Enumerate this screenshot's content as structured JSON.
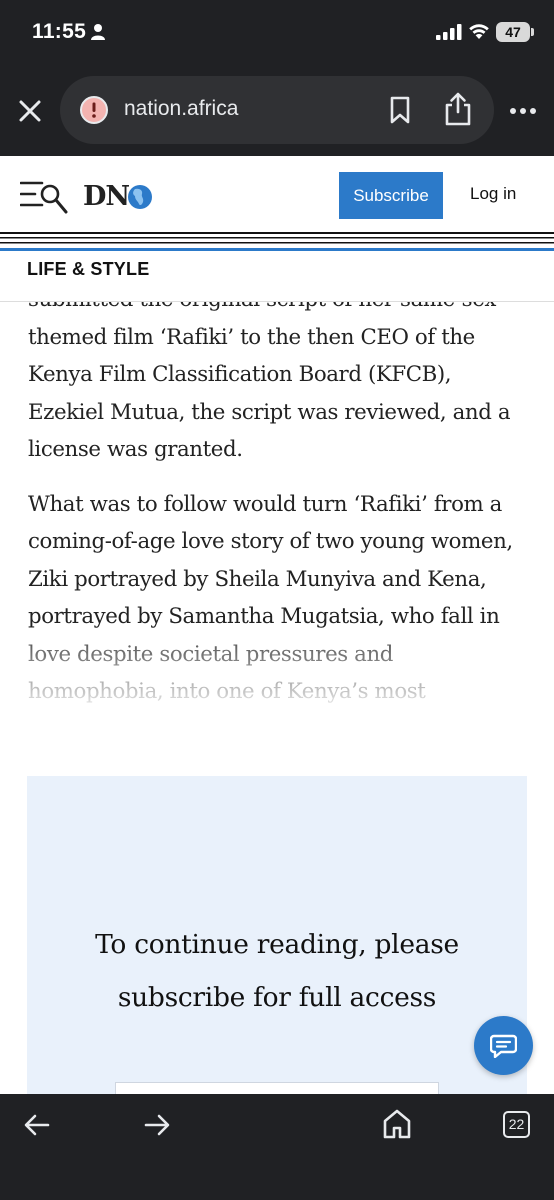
{
  "status_bar": {
    "time": "11:55",
    "battery": "47"
  },
  "browser": {
    "url": "nation.africa",
    "tab_count": "22"
  },
  "site": {
    "logo_text": "DN",
    "subscribe_label": "Subscribe",
    "login_label": "Log in",
    "section": "LIFE & STYLE",
    "brand_color": "#2c7ac9"
  },
  "article": {
    "paragraphs": [
      "submitted the original script of her same-sex-themed film ‘Rafiki’ to the then CEO of the Kenya Film Classification Board (KFCB), Ezekiel Mutua, the script was reviewed, and a license was granted.",
      "What was to follow would turn ‘Rafiki’ from a coming-of-age love story of two young women, Ziki portrayed by Sheila Munyiva and Kena, portrayed by Samantha Mugatsia, who fall in love despite societal pressures and homophobia, into one of Kenya’s most"
    ]
  },
  "paywall": {
    "line1": "To continue reading, please",
    "line2": "subscribe for full access"
  },
  "icons": {
    "close": "close-icon",
    "alert": "alert-icon",
    "bookmark": "bookmark-icon",
    "share": "share-icon",
    "more": "more-vert-icon",
    "menu_search": "menu-search-icon",
    "chat": "chat-icon",
    "back": "arrow-left-icon",
    "forward": "arrow-right-icon",
    "home": "home-icon"
  }
}
